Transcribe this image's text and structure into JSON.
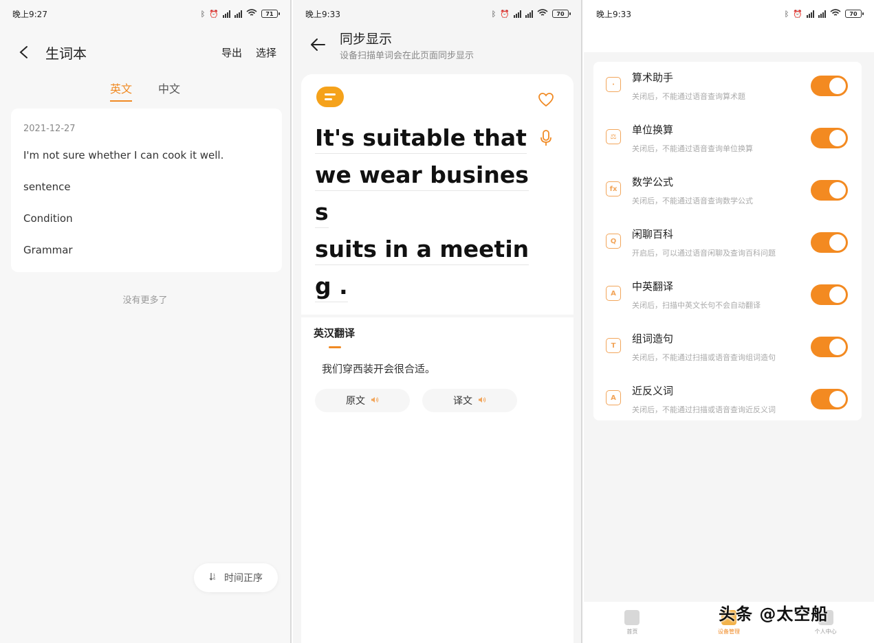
{
  "phone1": {
    "status": {
      "time": "晚上9:27",
      "battery": "71"
    },
    "header": {
      "title": "生词本",
      "export_label": "导出",
      "select_label": "选择"
    },
    "tabs": [
      {
        "label": "英文",
        "active": true
      },
      {
        "label": "中文",
        "active": false
      }
    ],
    "card": {
      "date": "2021-12-27",
      "items": [
        "I'm not sure whether I can cook it well.",
        "sentence",
        "Condition",
        "Grammar"
      ]
    },
    "no_more": "没有更多了",
    "sort_button": "时间正序"
  },
  "phone2": {
    "status": {
      "time": "晚上9:33",
      "battery": "70"
    },
    "header": {
      "title": "同步显示",
      "subtitle": "设备扫描单词会在此页面同步显示"
    },
    "scan_lines": [
      "It's suitable that",
      "we wear busines",
      "s",
      "suits in a meetin",
      "g ."
    ],
    "translation": {
      "label": "英汉翻译",
      "text": "我们穿西装开会很合适。",
      "original_button": "原文",
      "translated_button": "译文"
    }
  },
  "phone3": {
    "status": {
      "time": "晚上9:33",
      "battery": "70"
    },
    "settings": [
      {
        "title": "算术助手",
        "desc": "关闭后，不能通过语音查询算术题",
        "icon": "calculator-icon",
        "glyph": "·",
        "enabled": true
      },
      {
        "title": "单位换算",
        "desc": "关闭后，不能通过语音查询单位换算",
        "icon": "scale-icon",
        "glyph": "⚖",
        "enabled": true
      },
      {
        "title": "数学公式",
        "desc": "关闭后，不能通过语音查询数学公式",
        "icon": "formula-icon",
        "glyph": "fx",
        "enabled": true
      },
      {
        "title": "闲聊百科",
        "desc": "开启后，可以通过语音闲聊及查询百科问题",
        "icon": "chat-icon",
        "glyph": "Q",
        "enabled": true
      },
      {
        "title": "中英翻译",
        "desc": "关闭后，扫描中英文长句不会自动翻译",
        "icon": "translate-icon",
        "glyph": "A",
        "enabled": true
      },
      {
        "title": "组词造句",
        "desc": "关闭后，不能通过扫描或语音查询组词造句",
        "icon": "compose-icon",
        "glyph": "T",
        "enabled": true
      },
      {
        "title": "近反义词",
        "desc": "关闭后，不能通过扫描或语音查询近反义词",
        "icon": "synonym-icon",
        "glyph": "A",
        "enabled": true
      }
    ],
    "nav": [
      {
        "label": "首页",
        "icon": "home-icon",
        "active": false
      },
      {
        "label": "设备管理",
        "icon": "device-icon",
        "active": true
      },
      {
        "label": "个人中心",
        "icon": "profile-icon",
        "active": false
      }
    ],
    "watermark": "头条 @太空船"
  },
  "colors": {
    "accent": "#f08a24",
    "toggle_on": "#f38a21"
  }
}
